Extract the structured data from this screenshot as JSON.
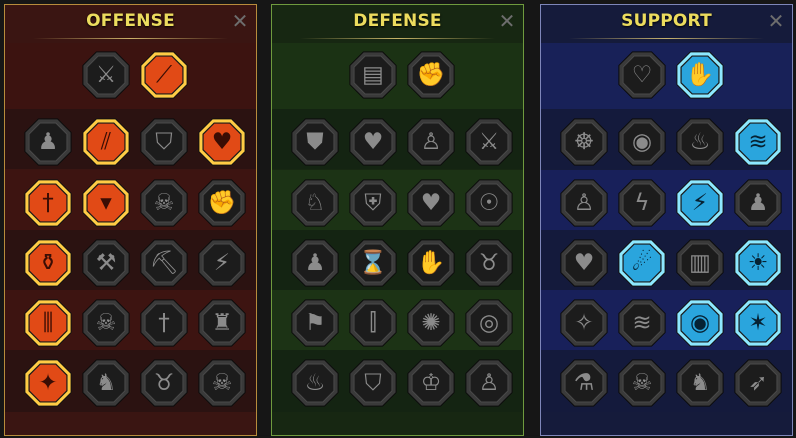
{
  "panels": [
    {
      "id": "offense",
      "title": "OFFENSE",
      "close": "✕",
      "colors": {
        "border": "#b78c3c",
        "bg": "#3a1512",
        "active_fill": "#e14a16",
        "active_border": "#ffcc45"
      },
      "rows": [
        [
          {
            "icon": "crossed-swords-icon",
            "active": false
          },
          {
            "icon": "slash-strike-icon",
            "active": true
          }
        ],
        [
          {
            "icon": "warrior-bust-icon",
            "active": false
          },
          {
            "icon": "blade-slash-icon",
            "active": true
          },
          {
            "icon": "shield-pierce-icon",
            "active": false
          },
          {
            "icon": "heart-sword-icon",
            "active": true
          }
        ],
        [
          {
            "icon": "dagger-figure-icon",
            "active": true
          },
          {
            "icon": "fanged-maw-icon",
            "active": true
          },
          {
            "icon": "skull-smoke-icon",
            "active": false
          },
          {
            "icon": "fist-strike-icon",
            "active": false
          }
        ],
        [
          {
            "icon": "blood-drop-blade-icon",
            "active": true
          },
          {
            "icon": "hammer-icon",
            "active": false
          },
          {
            "icon": "axe-icon",
            "active": false
          },
          {
            "icon": "lightning-chain-icon",
            "active": false
          }
        ],
        [
          {
            "icon": "triple-blade-icon",
            "active": true
          },
          {
            "icon": "skull-icon",
            "active": false
          },
          {
            "icon": "dagger-icon",
            "active": false
          },
          {
            "icon": "armored-warrior-icon",
            "active": false
          }
        ],
        [
          {
            "icon": "sword-spark-icon",
            "active": true
          },
          {
            "icon": "knight-helmet-icon",
            "active": false
          },
          {
            "icon": "demon-icon",
            "active": false
          },
          {
            "icon": "skull-warrior-icon",
            "active": false
          }
        ]
      ]
    },
    {
      "id": "defense",
      "title": "DEFENSE",
      "close": "✕",
      "colors": {
        "border": "#6f9a3e",
        "bg": "#172712",
        "active_fill": "#6aa33a",
        "active_border": "#c8f07a"
      },
      "rows": [
        [
          {
            "icon": "armor-plates-icon",
            "active": false
          },
          {
            "icon": "raised-fist-icon",
            "active": false
          }
        ],
        [
          {
            "icon": "shoulder-guard-icon",
            "active": false
          },
          {
            "icon": "heart-organ-icon",
            "active": false
          },
          {
            "icon": "strongman-icon",
            "active": false
          },
          {
            "icon": "crossed-blades-icon",
            "active": false
          }
        ],
        [
          {
            "icon": "leaping-figure-icon",
            "active": false
          },
          {
            "icon": "knight-shield-icon",
            "active": false
          },
          {
            "icon": "skull-heart-icon",
            "active": false
          },
          {
            "icon": "halo-head-icon",
            "active": false
          }
        ],
        [
          {
            "icon": "crowd-icon",
            "active": false
          },
          {
            "icon": "hourglass-icon",
            "active": false
          },
          {
            "icon": "hand-sign-icon",
            "active": false
          },
          {
            "icon": "bull-icon",
            "active": false
          }
        ],
        [
          {
            "icon": "running-figure-icon",
            "active": false
          },
          {
            "icon": "claw-marks-icon",
            "active": false
          },
          {
            "icon": "radiant-skull-icon",
            "active": false
          },
          {
            "icon": "swirl-shield-icon",
            "active": false
          }
        ],
        [
          {
            "icon": "warrior-flame-icon",
            "active": false
          },
          {
            "icon": "winged-shield-icon",
            "active": false
          },
          {
            "icon": "bearded-hero-icon",
            "active": false
          },
          {
            "icon": "flexing-figure-icon",
            "active": false
          }
        ]
      ]
    },
    {
      "id": "support",
      "title": "SUPPORT",
      "close": "✕",
      "colors": {
        "border": "#7e86b9",
        "bg": "#151b3b",
        "active_fill": "#2aa5dd",
        "active_border": "#8de8ff"
      },
      "rows": [
        [
          {
            "icon": "heart-sparkle-icon",
            "active": false
          },
          {
            "icon": "healing-hand-icon",
            "active": true
          }
        ],
        [
          {
            "icon": "praying-hands-icon",
            "active": false
          },
          {
            "icon": "ripple-shield-icon",
            "active": false
          },
          {
            "icon": "flame-skull-icon",
            "active": false
          },
          {
            "icon": "speed-rush-icon",
            "active": true
          }
        ],
        [
          {
            "icon": "power-figure-icon",
            "active": false
          },
          {
            "icon": "lightning-bolt-icon",
            "active": false
          },
          {
            "icon": "storm-legs-icon",
            "active": true
          },
          {
            "icon": "shadow-figures-icon",
            "active": false
          }
        ],
        [
          {
            "icon": "chained-heart-icon",
            "active": false
          },
          {
            "icon": "comet-icon",
            "active": true
          },
          {
            "icon": "open-book-icon",
            "active": false
          },
          {
            "icon": "fury-face-icon",
            "active": true
          }
        ],
        [
          {
            "icon": "star-compass-icon",
            "active": false
          },
          {
            "icon": "swift-boots-icon",
            "active": false
          },
          {
            "icon": "all-seeing-eye-icon",
            "active": true
          },
          {
            "icon": "stunned-figure-icon",
            "active": true
          }
        ],
        [
          {
            "icon": "poison-flask-icon",
            "active": false
          },
          {
            "icon": "skull-icon",
            "active": false
          },
          {
            "icon": "claw-beast-icon",
            "active": false
          },
          {
            "icon": "eagle-head-icon",
            "active": false
          }
        ]
      ]
    }
  ]
}
